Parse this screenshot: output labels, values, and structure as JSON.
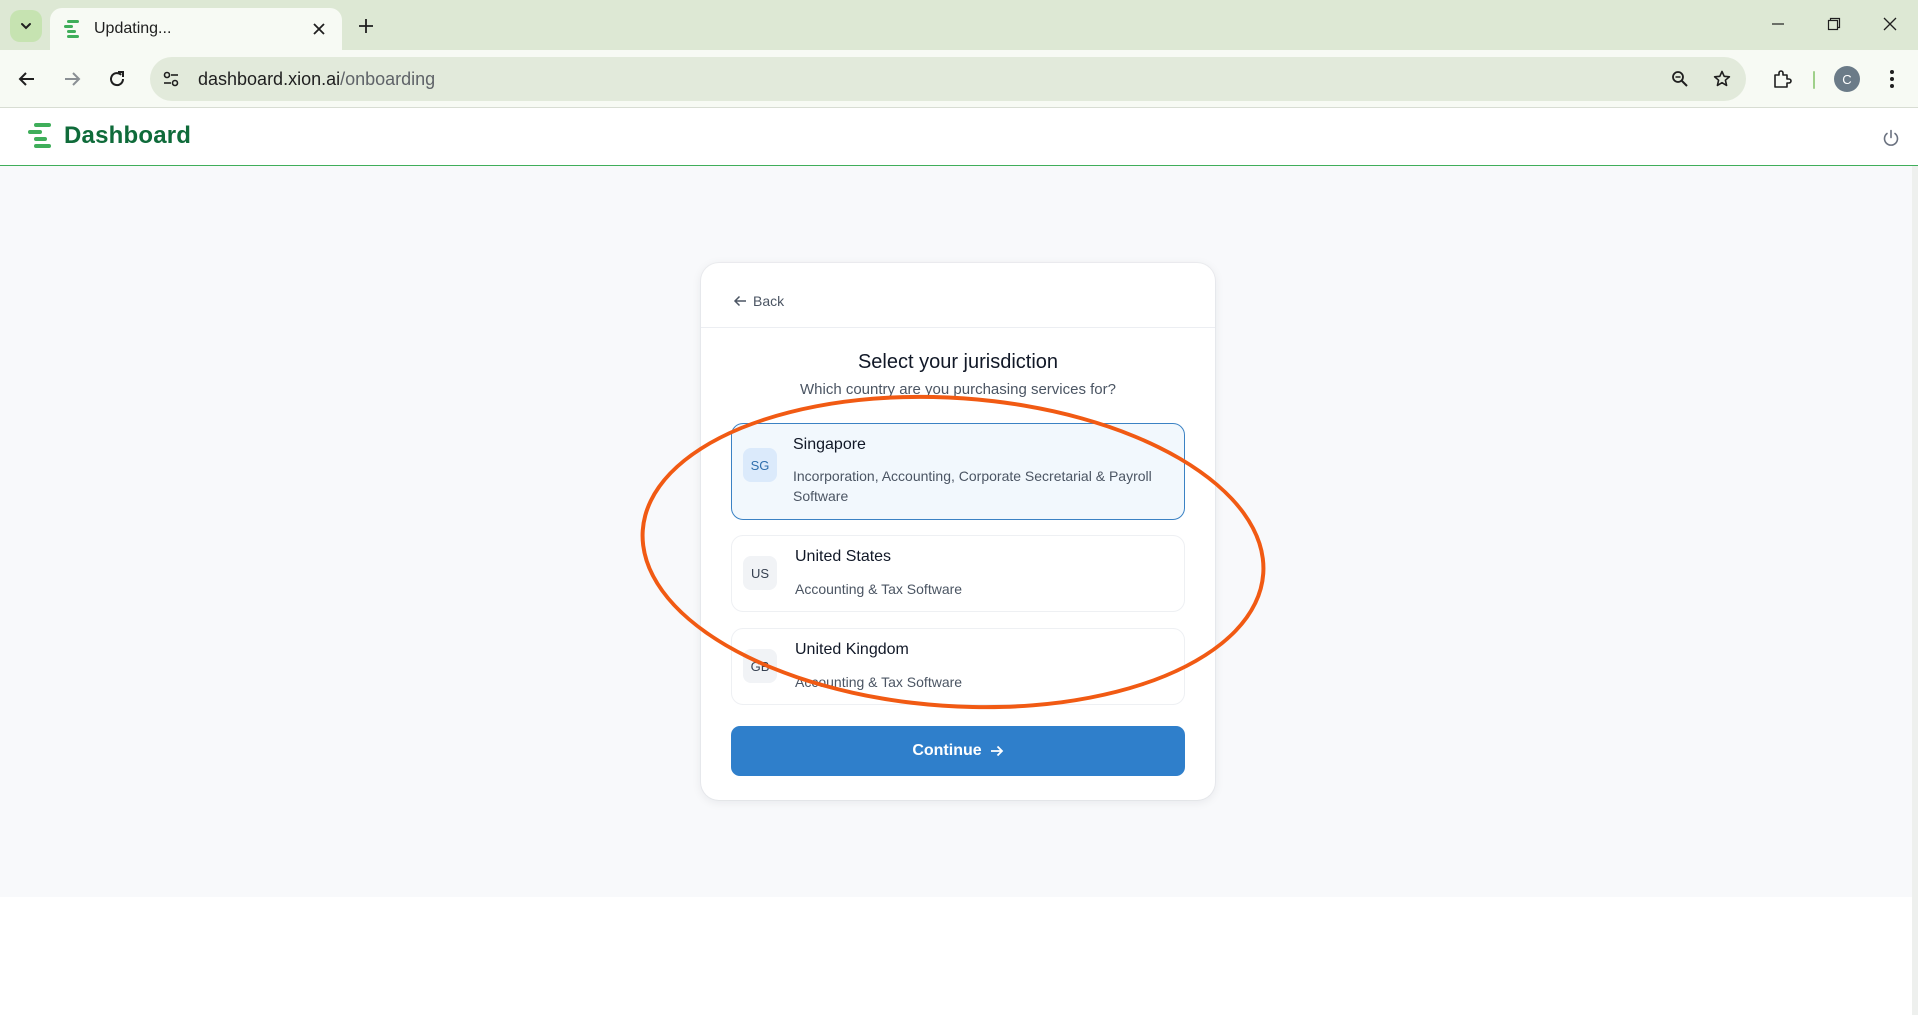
{
  "browser": {
    "tab_title": "Updating...",
    "url_host": "dashboard.xion.ai",
    "url_path": "/onboarding",
    "profile_initial": "C"
  },
  "header": {
    "brand": "Dashboard",
    "brand_color": "#0f6b3a"
  },
  "card": {
    "back_label": "Back",
    "title": "Select your jurisdiction",
    "subtitle": "Which country are you purchasing services for?",
    "options": [
      {
        "code": "SG",
        "name": "Singapore",
        "desc": "Incorporation, Accounting, Corporate Secretarial & Payroll Software",
        "selected": true
      },
      {
        "code": "US",
        "name": "United States",
        "desc": "Accounting & Tax Software",
        "selected": false
      },
      {
        "code": "GB",
        "name": "United Kingdom",
        "desc": "Accounting & Tax Software",
        "selected": false
      }
    ],
    "continue_label": "Continue"
  },
  "colors": {
    "accent": "#2f7fcb",
    "annotation": "#f15a13",
    "header_border": "#3fae5a"
  },
  "icons": [
    "tab-search-icon",
    "xion-logo-icon",
    "close-icon",
    "plus-icon",
    "minimize-icon",
    "restore-icon",
    "window-close-icon",
    "back-arrow-icon",
    "forward-arrow-icon",
    "reload-icon",
    "site-info-icon",
    "zoom-icon",
    "star-icon",
    "extensions-icon",
    "kebab-menu-icon",
    "power-icon",
    "arrow-left-icon",
    "arrow-right-icon"
  ]
}
